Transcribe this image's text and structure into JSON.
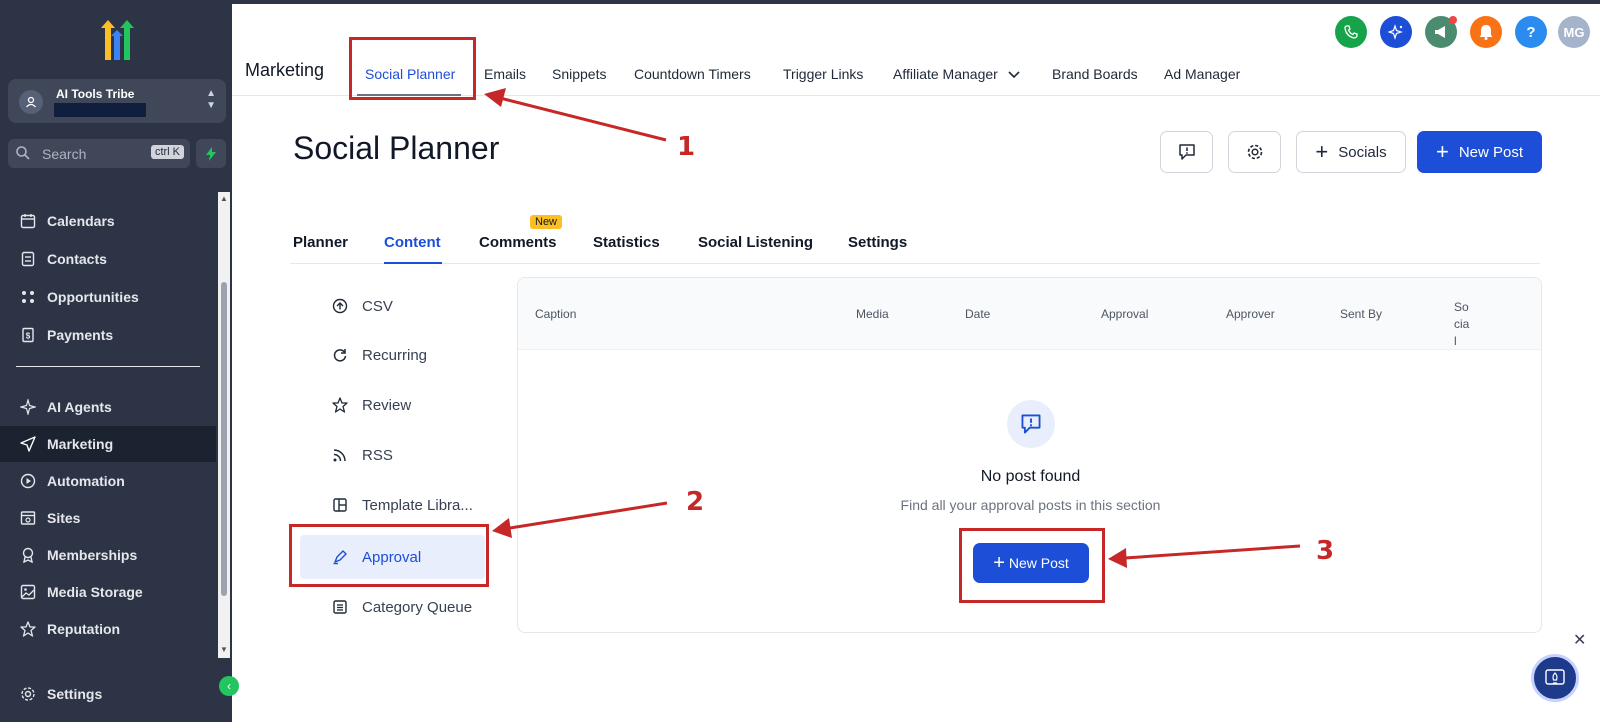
{
  "sidebar": {
    "account_name": "AI Tools Tribe",
    "search_placeholder": "Search",
    "search_shortcut": "ctrl K",
    "items": [
      {
        "label": "Calendars",
        "icon": "calendar-icon"
      },
      {
        "label": "Contacts",
        "icon": "contacts-icon"
      },
      {
        "label": "Opportunities",
        "icon": "opportunities-icon"
      },
      {
        "label": "Payments",
        "icon": "payments-icon"
      },
      {
        "label": "AI Agents",
        "icon": "sparkle-icon"
      },
      {
        "label": "Marketing",
        "icon": "send-icon"
      },
      {
        "label": "Automation",
        "icon": "automation-icon"
      },
      {
        "label": "Sites",
        "icon": "sites-icon"
      },
      {
        "label": "Memberships",
        "icon": "award-icon"
      },
      {
        "label": "Media Storage",
        "icon": "image-icon"
      },
      {
        "label": "Reputation",
        "icon": "star-icon"
      },
      {
        "label": "Settings",
        "icon": "gear-icon"
      }
    ]
  },
  "header": {
    "title": "Marketing",
    "tabs": [
      "Social Planner",
      "Emails",
      "Snippets",
      "Countdown Timers",
      "Trigger Links",
      "Affiliate Manager",
      "Brand Boards",
      "Ad Manager"
    ],
    "avatar_initials": "MG",
    "help_label": "?"
  },
  "page": {
    "title": "Social Planner",
    "socials_label": "Socials",
    "new_post_label": "New Post",
    "subtabs": [
      "Planner",
      "Content",
      "Comments",
      "Statistics",
      "Social Listening",
      "Settings"
    ],
    "new_badge": "New"
  },
  "left_menu": [
    "CSV",
    "Recurring",
    "Review",
    "RSS",
    "Template Libra...",
    "Approval",
    "Category Queue"
  ],
  "table": {
    "columns": [
      "Caption",
      "Media",
      "Date",
      "Approval",
      "Approver",
      "Sent By",
      "Social"
    ],
    "empty_title": "No post found",
    "empty_subtitle": "Find all your approval posts in this section",
    "empty_button": "New Post"
  },
  "annotations": [
    "1",
    "2",
    "3"
  ],
  "colors": {
    "sidebar_bg": "#2c3446",
    "primary": "#1d4ed8",
    "annotation_red": "#c62828",
    "badge_yellow": "#fbbf24",
    "phone_green": "#16a34a",
    "notify_orange": "#f97316"
  }
}
